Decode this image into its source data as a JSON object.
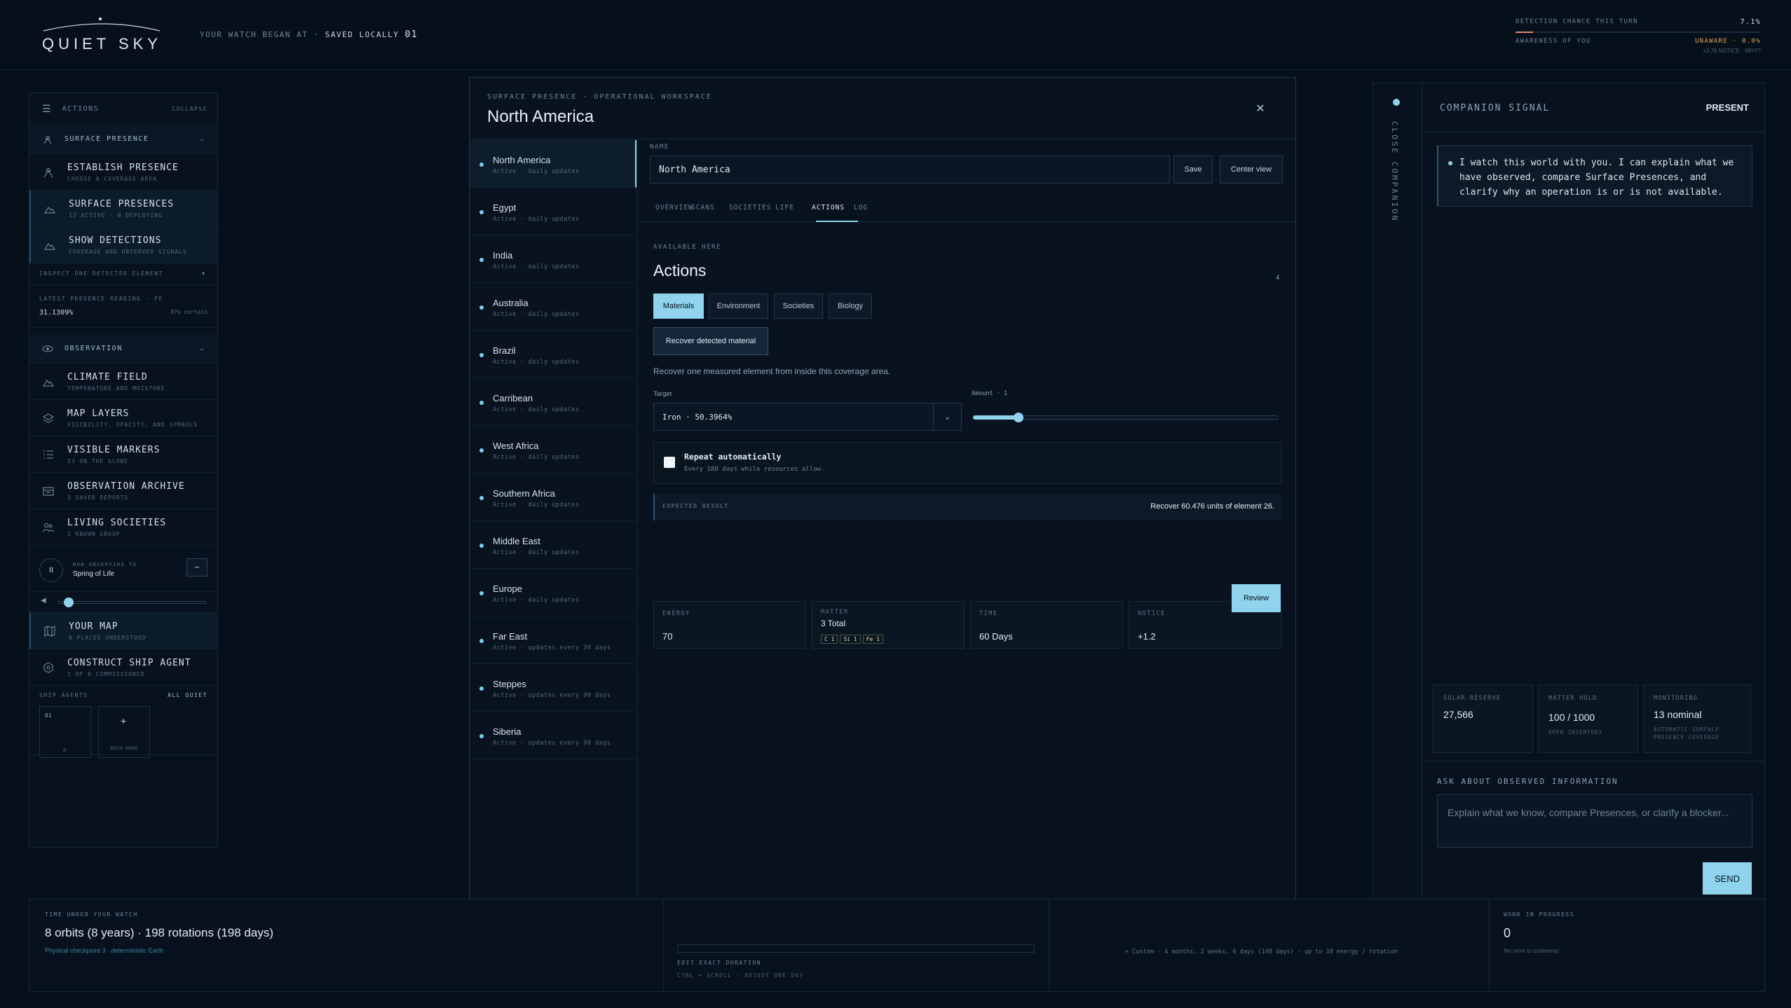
{
  "app": {
    "title": "QUIET SKY",
    "watch_label": "YOUR WATCH BEGAN AT",
    "saved_label": "SAVED LOCALLY",
    "saved_count": "01"
  },
  "detection": {
    "chance_label": "DETECTION CHANCE THIS TURN",
    "chance_value": "7.1%",
    "chance_fraction": 0.071,
    "awareness_label": "AWARENESS OF YOU",
    "awareness_value": "UNAWARE · 0.0%",
    "sub": "+3.78 NOTICE · WHY?"
  },
  "left_panel": {
    "header": "ACTIONS",
    "collapse": "COLLAPSE",
    "surface_section": "SURFACE PRESENCE",
    "items_a": [
      {
        "title": "ESTABLISH PRESENCE",
        "sub": "CHOOSE A COVERAGE AREA",
        "icon": "antenna-icon"
      },
      {
        "title": "SURFACE PRESENCES",
        "sub": "13 ACTIVE · 0 DEPLOYING",
        "icon": "mountain-icon"
      },
      {
        "title": "SHOW DETECTIONS",
        "sub": "COVERAGE AND OBSERVED SIGNALS",
        "icon": "mountain-icon"
      }
    ],
    "inspect": "INSPECT ONE DETECTED ELEMENT",
    "reading_label": "LATEST PRESENCE READING · FE",
    "reading_value": "31.1309%",
    "reading_certainty": "87% certain",
    "observation_section": "OBSERVATION",
    "items_b": [
      {
        "title": "CLIMATE FIELD",
        "sub": "TEMPERATURE AND MOISTURE",
        "icon": "mountain-icon"
      },
      {
        "title": "MAP LAYERS",
        "sub": "VISIBILITY, OPACITY, AND SYMBOLS",
        "icon": "layers-icon"
      },
      {
        "title": "VISIBLE MARKERS",
        "sub": "53 ON THE GLOBE",
        "icon": "list-icon"
      },
      {
        "title": "OBSERVATION ARCHIVE",
        "sub": "3 SAVED REPORTS",
        "icon": "archive-icon"
      },
      {
        "title": "LIVING SOCIETIES",
        "sub": "1 KNOWN GROUP",
        "icon": "people-icon"
      }
    ],
    "now_observing_label": "NOW OBSERVING TO",
    "now_observing_value": "Spring of Life",
    "volume_fraction": 0.05,
    "items_c": [
      {
        "title": "YOUR MAP",
        "sub": "8 PLACES UNDERSTOOD",
        "icon": "map-icon"
      },
      {
        "title": "CONSTRUCT SHIP AGENT",
        "sub": "1 OF 8 COMMISSIONED",
        "icon": "hexagon-icon"
      }
    ],
    "ship_agents_label": "SHIP AGENTS",
    "ship_agents_status": "ALL QUIET",
    "agent_slot": "01",
    "agent_slot_sub": "0",
    "build_agent": "BUILD AGENT"
  },
  "modal": {
    "subtitle": "SURFACE PRESENCE · OPERATIONAL WORKSPACE",
    "title": "North America",
    "regions": [
      {
        "name": "North America",
        "status": "Active · daily updates"
      },
      {
        "name": "Egypt",
        "status": "Active · daily updates"
      },
      {
        "name": "India",
        "status": "Active · daily updates"
      },
      {
        "name": "Australia",
        "status": "Active · daily updates"
      },
      {
        "name": "Brazil",
        "status": "Active · daily updates"
      },
      {
        "name": "Carribean",
        "status": "Active · daily updates"
      },
      {
        "name": "West Africa",
        "status": "Active · daily updates"
      },
      {
        "name": "Southern Africa",
        "status": "Active · daily updates"
      },
      {
        "name": "Middle East",
        "status": "Active · daily updates"
      },
      {
        "name": "Europe",
        "status": "Active · daily updates"
      },
      {
        "name": "Far East",
        "status": "Active · updates every 30 days"
      },
      {
        "name": "Steppes",
        "status": "Active · updates every 90 days"
      },
      {
        "name": "Siberia",
        "status": "Active · updates every 90 days"
      }
    ],
    "name_label": "NAME",
    "name_value": "North America",
    "save": "Save",
    "center_view": "Center view",
    "tabs": [
      "OVERVIEW",
      "SCANS",
      "SOCIETIES",
      "LIFE",
      "ACTIONS",
      "LOG"
    ],
    "available_here": "AVAILABLE HERE",
    "actions_title": "Actions",
    "actions_count": "4",
    "chips": [
      "Materials",
      "Environment",
      "Societies",
      "Biology"
    ],
    "recover_btn": "Recover detected material",
    "recover_desc": "Recover one measured element from inside this coverage area.",
    "target_label": "Target",
    "target_value": "Iron · 50.3964%",
    "amount_label": "Amount · 1",
    "amount_fraction": 0.15,
    "repeat_title": "Repeat automatically",
    "repeat_sub": "Every 180 days while resources allow.",
    "expected_label": "EXPECTED RESULT",
    "expected_value": "Recover 60.476 units of element 26.",
    "energy_label": "ENERGY",
    "energy_value": "70",
    "matter_label": "MATTER",
    "matter_value": "3 Total",
    "matter_chips": [
      "C 1",
      "Si 1",
      "Fe 1"
    ],
    "time_label": "TIME",
    "time_value": "60 Days",
    "notice_label": "NOTICE",
    "notice_value": "+1.2",
    "review": "Review"
  },
  "companion": {
    "rail_label": "CLOSE COMPANION",
    "title": "COMPANION SIGNAL",
    "status": "PRESENT",
    "message": "I watch this world with you. I can explain what we have observed, compare Surface Presences, and clarify why an operation is or is not available.",
    "solar_label": "SOLAR RESERVE",
    "solar_value": "27,566",
    "matter_label": "MATTER HOLD",
    "matter_value": "100 / 1000",
    "matter_sub": "OPEN INVENTORY",
    "monitoring_label": "MONITORING",
    "monitoring_value": "13 nominal",
    "monitoring_sub": "AUTOMATIC SURFACE PRESENCE COVERAGE",
    "ask_label": "ASK ABOUT OBSERVED INFORMATION",
    "ask_placeholder": "Explain what we know, compare Presences, or clarify a blocker...",
    "send": "SEND"
  },
  "bottom": {
    "time_label": "TIME UNDER YOUR WATCH",
    "time_value": "8 orbits (8 years) · 198 rotations (198 days)",
    "time_sub": "Physical checkpoint 3 · deterministic Earth",
    "edit_label": "EDIT EXACT DURATION",
    "edit_sub": "CTRL + SCROLL · ADJUST ONE DAY",
    "custom_text": "+ Custom · 4 months, 2 weeks, 6 days (148 days) · up to 10 energy / rotation",
    "wip_label": "WORK IN PROGRESS",
    "wip_value": "0",
    "wip_sub": "No work is underway"
  }
}
